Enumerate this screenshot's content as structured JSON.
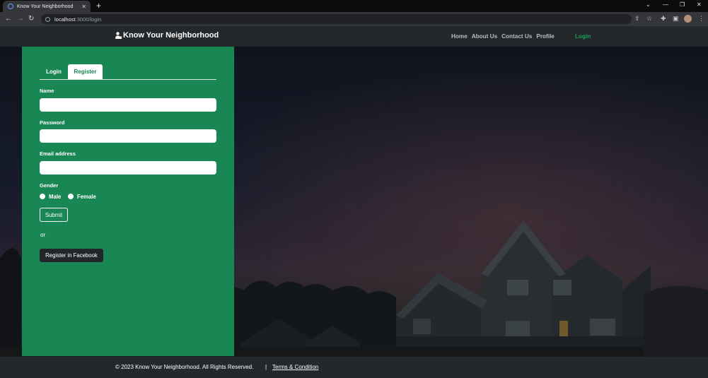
{
  "browser": {
    "tab_title": "Know Your Neighborhood",
    "new_tab_icon": "+",
    "url_host": "localhost",
    "url_rest": ":3000/login"
  },
  "header": {
    "brand": "Know Your Neighborhood",
    "nav": [
      "Home",
      "About Us",
      "Contact Us",
      "Profile"
    ],
    "login": "Login"
  },
  "form": {
    "tabs": {
      "login": "Login",
      "register": "Register"
    },
    "name_label": "Name",
    "name_value": "",
    "password_label": "Password",
    "password_value": "",
    "email_label": "Email address",
    "email_value": "",
    "gender_label": "Gender",
    "gender_options": [
      "Male",
      "Female"
    ],
    "submit": "Submit",
    "or": "or",
    "facebook": "Register in Facebook"
  },
  "footer": {
    "copyright": "© 2023 Know Your Neighborhood. All Rights Reserved.",
    "separator": "|",
    "terms": "Terms & Condition"
  },
  "colors": {
    "brand_green": "#198754",
    "header_bg": "#25282b",
    "page_bg": "#1f2226"
  }
}
